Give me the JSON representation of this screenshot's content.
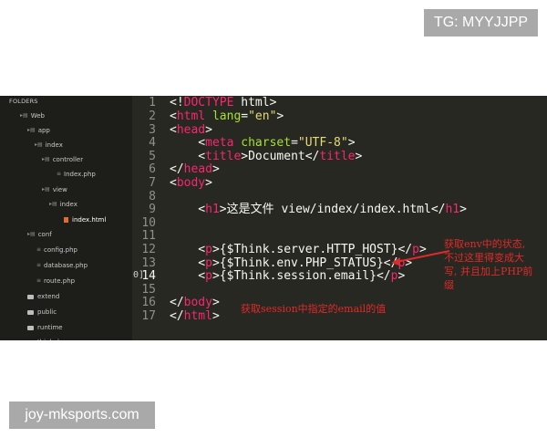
{
  "watermarks": {
    "top": "TG: MYYJJPP",
    "bottom": "joy-mksports.com"
  },
  "sidebar": {
    "title": "FOLDERS",
    "items": [
      {
        "label": "Web",
        "icon": "folder-open-icon"
      },
      {
        "label": "app",
        "icon": "folder-open-icon"
      },
      {
        "label": "index",
        "icon": "folder-open-icon"
      },
      {
        "label": "controller",
        "icon": "folder-open-icon"
      },
      {
        "label": "Index.php",
        "icon": "file-icon"
      },
      {
        "label": "view",
        "icon": "folder-open-icon"
      },
      {
        "label": "index",
        "icon": "folder-open-icon"
      },
      {
        "label": "index.html",
        "icon": "html-file-icon"
      },
      {
        "label": "conf",
        "icon": "folder-open-icon"
      },
      {
        "label": "config.php",
        "icon": "file-icon"
      },
      {
        "label": "database.php",
        "icon": "file-icon"
      },
      {
        "label": "route.php",
        "icon": "file-icon"
      },
      {
        "label": "extend",
        "icon": "folder-icon"
      },
      {
        "label": "public",
        "icon": "folder-icon"
      },
      {
        "label": "runtime",
        "icon": "folder-icon"
      },
      {
        "label": "thinkphp",
        "icon": "folder-icon"
      }
    ]
  },
  "editor": {
    "line_numbers": [
      "1",
      "2",
      "3",
      "4",
      "5",
      "6",
      "7",
      "8",
      "9",
      "10",
      "11",
      "12",
      "13",
      "14",
      "15",
      "16",
      "17"
    ],
    "current_line_marker": "0]",
    "lines": {
      "l1_a": "<!",
      "l1_b": "DOCTYPE",
      "l1_c": " html>",
      "l2_a": "<",
      "l2_b": "html",
      "l2_c": " lang",
      "l2_d": "=",
      "l2_e": "\"en\"",
      "l2_f": ">",
      "l3_a": "<",
      "l3_b": "head",
      "l3_c": ">",
      "l4_a": "    <",
      "l4_b": "meta",
      "l4_c": " charset",
      "l4_d": "=",
      "l4_e": "\"UTF-8\"",
      "l4_f": ">",
      "l5_a": "    <",
      "l5_b": "title",
      "l5_c": ">Document</",
      "l5_d": "title",
      "l5_e": ">",
      "l6_a": "</",
      "l6_b": "head",
      "l6_c": ">",
      "l7_a": "<",
      "l7_b": "body",
      "l7_c": ">",
      "l9_a": "    <",
      "l9_b": "h1",
      "l9_c": ">",
      "l9_d": "这是文件",
      "l9_e": " view/index/index.html</",
      "l9_f": "h1",
      "l9_g": ">",
      "l12_a": "    <",
      "l12_b": "p",
      "l12_c": ">{$Think.server.HTTP_HOST}</",
      "l12_d": "p",
      "l12_e": ">",
      "l13_a": "    <",
      "l13_b": "p",
      "l13_c": ">{$Think.env.PHP_STATUS}</",
      "l13_d": "p",
      "l13_e": ">",
      "l14_a": "    <",
      "l14_b": "p",
      "l14_c": ">{$Think.session.email}</",
      "l14_d": "p",
      "l14_e": ">",
      "l16_a": "</",
      "l16_b": "body",
      "l16_c": ">",
      "l17_a": "</",
      "l17_b": "html",
      "l17_c": ">"
    }
  },
  "annotations": {
    "env_note_1": "获取env中的状态,",
    "env_note_2": "不过这里得变成大",
    "env_note_3": "写, 并且加上PHP前",
    "env_note_4": "缀",
    "session_note": "获取session中指定的email的值"
  },
  "colors": {
    "editor_bg": "#272822",
    "sidebar_bg": "#1d1e1a",
    "tag": "#f92672",
    "attribute": "#a6e22e",
    "string": "#e6db74",
    "annotation": "#e02a2a"
  }
}
